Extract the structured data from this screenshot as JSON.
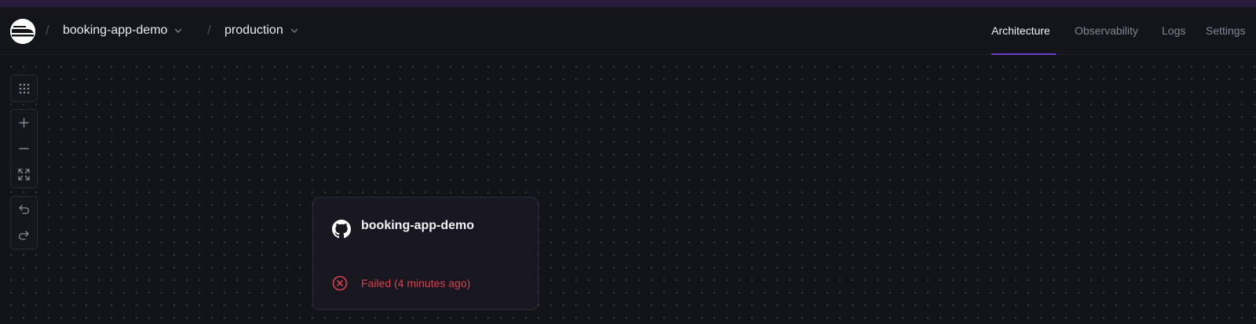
{
  "breadcrumb": {
    "separator": "/",
    "project": "booking-app-demo",
    "environment": "production"
  },
  "tabs": [
    {
      "label": "Architecture",
      "active": true
    },
    {
      "label": "Observability",
      "active": false
    },
    {
      "label": "Logs",
      "active": false
    },
    {
      "label": "Settings",
      "active": false
    }
  ],
  "canvas_controls": {
    "groups": [
      [
        "grid-icon"
      ],
      [
        "plus-icon",
        "minus-icon",
        "fit-view-icon"
      ],
      [
        "undo-icon",
        "redo-icon"
      ]
    ]
  },
  "service_card": {
    "icon": "github-icon",
    "name": "booking-app-demo",
    "status": {
      "icon": "x-circle-icon",
      "text": "Failed (4 minutes ago)",
      "color": "#d8424f"
    }
  },
  "colors": {
    "background": "#13131a",
    "accent": "#6a3bc7",
    "error": "#d8424f"
  }
}
